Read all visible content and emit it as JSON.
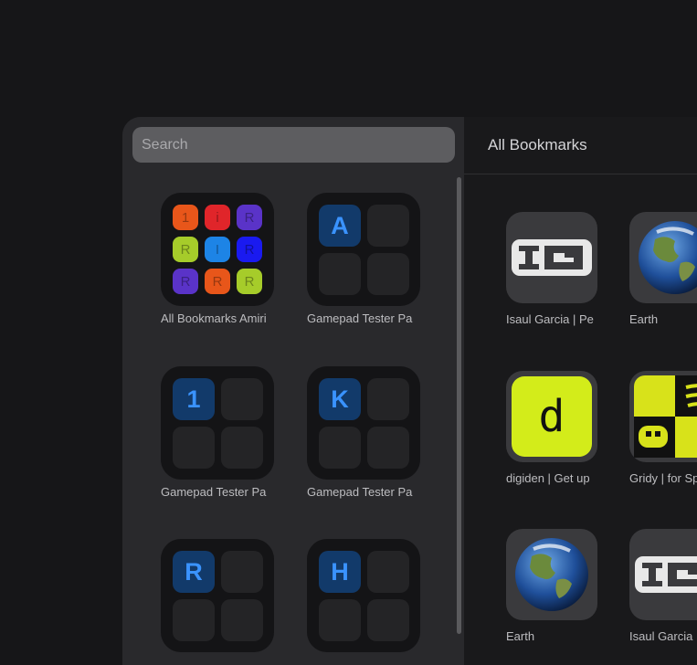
{
  "search": {
    "placeholder": "Search"
  },
  "folders": [
    {
      "label": "All Bookmarks Amiri"
    },
    {
      "label": "Gamepad Tester Pa",
      "letter": "A"
    },
    {
      "label": "Gamepad Tester Pa",
      "letter": "1"
    },
    {
      "label": "Gamepad Tester Pa",
      "letter": "K"
    },
    {
      "label": "",
      "letter": "R"
    },
    {
      "label": "",
      "letter": "H"
    }
  ],
  "grid_icons": [
    {
      "letter": "1",
      "color": "#e8561a"
    },
    {
      "letter": "i",
      "color": "#e0252a"
    },
    {
      "letter": "R",
      "color": "#5a33c8"
    },
    {
      "letter": "R",
      "color": "#a6cc2a"
    },
    {
      "letter": "I",
      "color": "#1d84e6"
    },
    {
      "letter": "R",
      "color": "#1a1af0"
    },
    {
      "letter": "R",
      "color": "#5a33c8"
    },
    {
      "letter": "R",
      "color": "#e8561a"
    },
    {
      "letter": "R",
      "color": "#a6cc2a"
    }
  ],
  "right": {
    "title": "All Bookmarks",
    "bookmarks": [
      {
        "label": "Isaul Garcia | Pe",
        "icon": "ig-logo-icon"
      },
      {
        "label": "Earth",
        "icon": "earth-icon"
      },
      {
        "label": "digiden | Get up",
        "icon": "digiden-icon",
        "letter": "d"
      },
      {
        "label": "Gridy | for Sp",
        "icon": "gridy-icon"
      },
      {
        "label": "Earth",
        "icon": "earth-icon"
      },
      {
        "label": "Isaul Garcia",
        "icon": "ig-logo-icon"
      }
    ]
  },
  "colors": {
    "accent_blue": "#3a93ff",
    "panel_bg": "#29292c",
    "digiden_bg": "#d3ec1a"
  }
}
